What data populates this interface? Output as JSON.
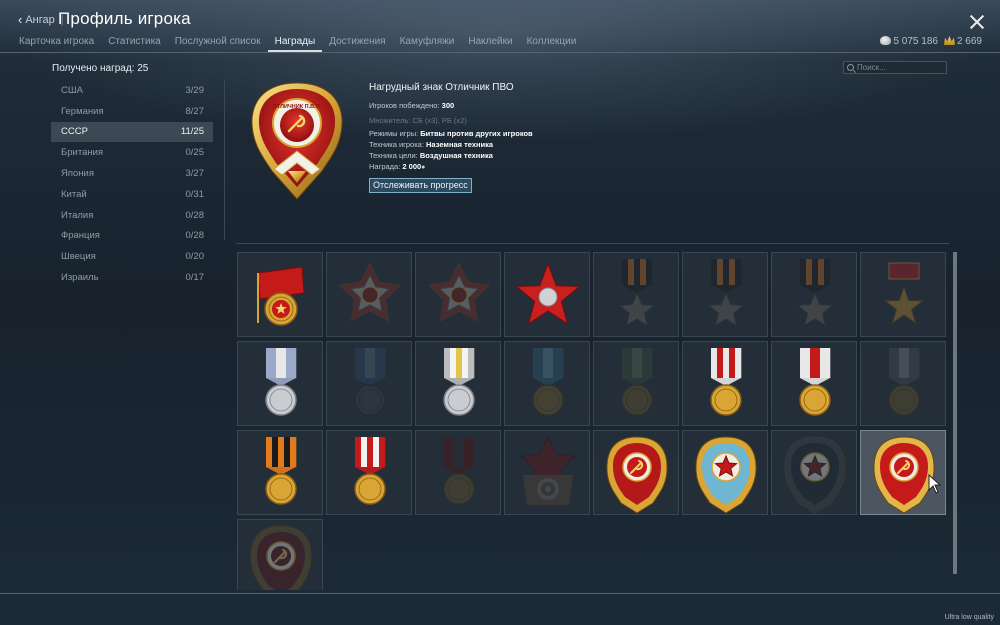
{
  "header": {
    "back_label": "Ангар",
    "title": "Профиль игрока",
    "tabs": [
      "Карточка игрока",
      "Статистика",
      "Послужной список",
      "Награды",
      "Достижения",
      "Камуфляжи",
      "Наклейки",
      "Коллекции"
    ],
    "active_tab": "Награды",
    "silver": "5 075 186",
    "gold": "2 669"
  },
  "awards_received": "Получено наград: 25",
  "search": {
    "placeholder": "Поиск..."
  },
  "nations": [
    {
      "name": "США",
      "count": "3/29"
    },
    {
      "name": "Германия",
      "count": "8/27"
    },
    {
      "name": "СССР",
      "count": "11/25"
    },
    {
      "name": "Британия",
      "count": "0/25"
    },
    {
      "name": "Япония",
      "count": "3/27"
    },
    {
      "name": "Китай",
      "count": "0/31"
    },
    {
      "name": "Италия",
      "count": "0/28"
    },
    {
      "name": "Франция",
      "count": "0/28"
    },
    {
      "name": "Швеция",
      "count": "0/20"
    },
    {
      "name": "Израиль",
      "count": "0/17"
    }
  ],
  "selected_nation": "СССР",
  "detail": {
    "title": "Нагрудный знак Отличник ПВО",
    "players_defeated_label": "Игроков побеждено:",
    "players_defeated_value": "300",
    "multiplier": "Множитель: СБ (x3), РБ (x2)",
    "modes_label": "Режимы игры:",
    "modes_value": "Битвы против других игроков",
    "player_vehicle_label": "Техника игрока:",
    "player_vehicle_value": "Наземная техника",
    "target_vehicle_label": "Техника цели:",
    "target_vehicle_value": "Воздушная техника",
    "reward_label": "Награда:",
    "reward_value": "2 000",
    "track_button": "Отслеживать прогресс",
    "medal_ribbon_text": "ОТЛИЧНИК П.В.О."
  },
  "awards": [
    {
      "type": "banner",
      "earned": true
    },
    {
      "type": "war-order",
      "earned": false
    },
    {
      "type": "war-order",
      "earned": false
    },
    {
      "type": "red-star",
      "earned": true
    },
    {
      "type": "star-striped",
      "earned": false
    },
    {
      "type": "star-striped",
      "earned": false
    },
    {
      "type": "star-striped",
      "earned": false
    },
    {
      "type": "hero-star",
      "earned": false
    },
    {
      "type": "medal-silver-blue",
      "earned": true
    },
    {
      "type": "medal-dark-blue",
      "earned": false
    },
    {
      "type": "medal-silver-grey",
      "earned": true
    },
    {
      "type": "medal-bronze-blue",
      "earned": false
    },
    {
      "type": "medal-bronze-green",
      "earned": false
    },
    {
      "type": "medal-gold-red",
      "earned": true
    },
    {
      "type": "medal-gold-redwhite",
      "earned": true
    },
    {
      "type": "medal-bronze-grey",
      "earned": false
    },
    {
      "type": "medal-gold-orange",
      "earned": true
    },
    {
      "type": "medal-gold-redwhite2",
      "earned": true
    },
    {
      "type": "medal-bronze-dark",
      "earned": false
    },
    {
      "type": "badge-target",
      "earned": false
    },
    {
      "type": "badge-red-gold",
      "earned": true
    },
    {
      "type": "badge-blue-wings",
      "earned": true
    },
    {
      "type": "badge-navy",
      "earned": false
    },
    {
      "type": "badge-pvo",
      "earned": true,
      "selected": true
    },
    {
      "type": "badge-pvo-dark",
      "earned": false
    }
  ],
  "footer": {
    "quality": "Ultra low quality"
  },
  "colors": {
    "accent_button_border": "#7fb1cc",
    "active_row": "#3c4853",
    "soviet_red": "#c41a1a",
    "gold": "#d9a535"
  }
}
